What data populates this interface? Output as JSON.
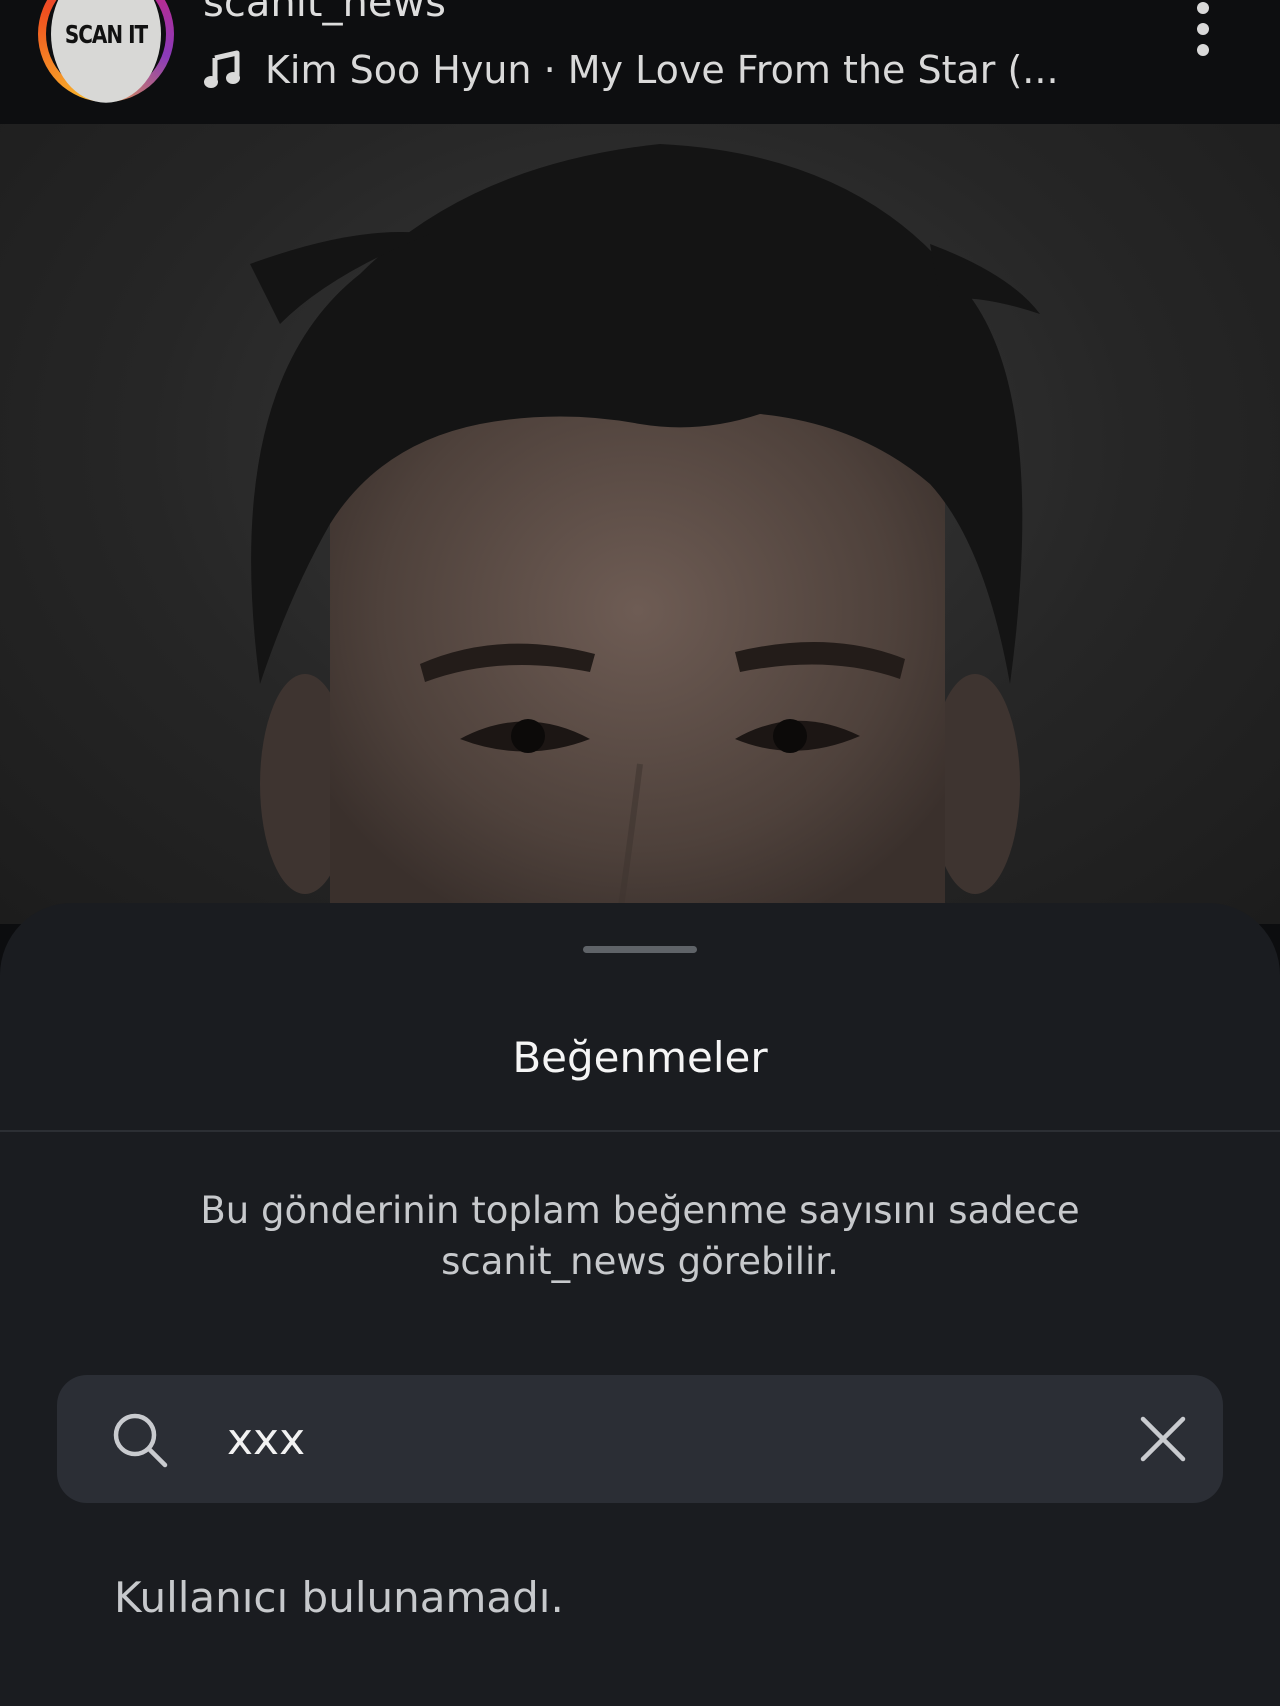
{
  "post": {
    "avatar_text": "SCAN IT",
    "username": "scanit_news",
    "music": "Kim Soo Hyun · My Love From the Star (..."
  },
  "likes_sheet": {
    "title": "Beğenmeler",
    "info": "Bu gönderinin toplam beğenme sayısını sadece scanit_news görebilir.",
    "search": {
      "value": "xxx"
    },
    "empty_message": "Kullanıcı bulunamadı."
  },
  "icons": {
    "music": "music-note-icon",
    "more": "more-vertical-icon",
    "search": "search-icon",
    "clear": "close-icon"
  }
}
